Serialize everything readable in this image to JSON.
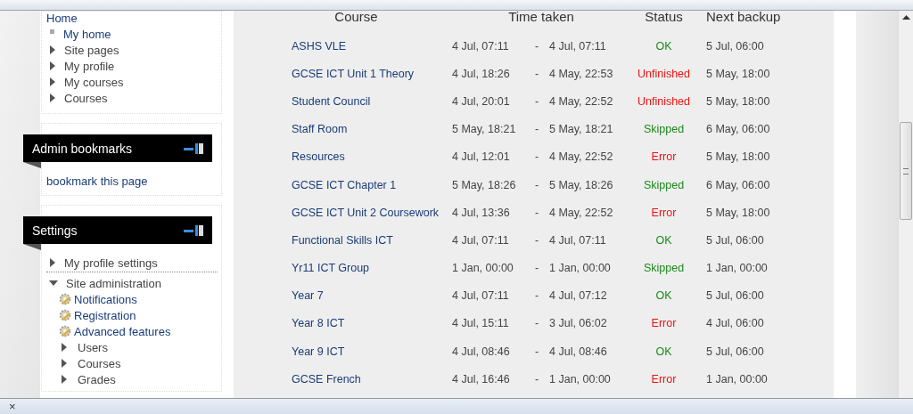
{
  "navigation": {
    "home": "Home",
    "items": [
      {
        "label": "My home",
        "kind": "leaf"
      },
      {
        "label": "Site pages",
        "kind": "branch"
      },
      {
        "label": "My profile",
        "kind": "branch"
      },
      {
        "label": "My courses",
        "kind": "branch"
      },
      {
        "label": "Courses",
        "kind": "branch"
      }
    ]
  },
  "admin_bookmarks": {
    "title": "Admin bookmarks",
    "link": "bookmark this page"
  },
  "settings": {
    "title": "Settings",
    "items": [
      {
        "label": "My profile settings",
        "expanded": false
      },
      {
        "label": "Site administration",
        "expanded": true,
        "children": [
          {
            "label": "Notifications",
            "kind": "page"
          },
          {
            "label": "Registration",
            "kind": "page"
          },
          {
            "label": "Advanced features",
            "kind": "page"
          },
          {
            "label": "Users",
            "kind": "branch"
          },
          {
            "label": "Courses",
            "kind": "branch"
          },
          {
            "label": "Grades",
            "kind": "branch"
          }
        ]
      }
    ]
  },
  "table": {
    "columns": [
      "Course",
      "Time taken",
      "Status",
      "Next backup"
    ],
    "rows": [
      {
        "course": "ASHS VLE",
        "start": "4 Jul, 07:11",
        "separator": "-",
        "end": "4 Jul, 07:11",
        "status": {
          "text": "OK",
          "kind": "ok"
        },
        "next": "5 Jul, 06:00"
      },
      {
        "course": "GCSE ICT Unit 1 Theory",
        "start": "4 Jul, 18:26",
        "separator": "-",
        "end": "4 May, 22:53",
        "status": {
          "text": "Unfinished",
          "kind": "error"
        },
        "next": "5 May, 18:00"
      },
      {
        "course": "Student Council",
        "start": "4 Jul, 20:01",
        "separator": "-",
        "end": "4 May, 22:52",
        "status": {
          "text": "Unfinished",
          "kind": "error"
        },
        "next": "5 May, 18:00"
      },
      {
        "course": "Staff Room",
        "start": "5 May, 18:21",
        "separator": "-",
        "end": "5 May, 18:21",
        "status": {
          "text": "Skipped",
          "kind": "ok"
        },
        "next": "6 May, 06:00"
      },
      {
        "course": "Resources",
        "start": "4 Jul, 12:01",
        "separator": "-",
        "end": "4 May, 22:52",
        "status": {
          "text": "Error",
          "kind": "error"
        },
        "next": "5 May, 18:00"
      },
      {
        "course": "GCSE ICT Chapter 1",
        "start": "5 May, 18:26",
        "separator": "-",
        "end": "5 May, 18:26",
        "status": {
          "text": "Skipped",
          "kind": "ok"
        },
        "next": "6 May, 06:00"
      },
      {
        "course": "GCSE ICT Unit 2 Coursework",
        "start": "4 Jul, 13:36",
        "separator": "-",
        "end": "4 May, 22:52",
        "status": {
          "text": "Error",
          "kind": "error"
        },
        "next": "5 May, 18:00"
      },
      {
        "course": "Functional Skills ICT",
        "start": "4 Jul, 07:11",
        "separator": "-",
        "end": "4 Jul, 07:11",
        "status": {
          "text": "OK",
          "kind": "ok"
        },
        "next": "5 Jul, 06:00"
      },
      {
        "course": "Yr11 ICT Group",
        "start": "1 Jan, 00:00",
        "separator": "-",
        "end": "1 Jan, 00:00",
        "status": {
          "text": "Skipped",
          "kind": "ok"
        },
        "next": "1 Jan, 00:00"
      },
      {
        "course": "Year 7",
        "start": "4 Jul, 07:11",
        "separator": "-",
        "end": "4 Jul, 07:12",
        "status": {
          "text": "OK",
          "kind": "ok"
        },
        "next": "5 Jul, 06:00"
      },
      {
        "course": "Year 8 ICT",
        "start": "4 Jul, 15:11",
        "separator": "-",
        "end": "3 Jul, 06:02",
        "status": {
          "text": "Error",
          "kind": "error"
        },
        "next": "4 Jul, 06:00"
      },
      {
        "course": "Year 9 ICT",
        "start": "4 Jul, 08:46",
        "separator": "-",
        "end": "4 Jul, 08:46",
        "status": {
          "text": "OK",
          "kind": "ok"
        },
        "next": "5 Jul, 06:00"
      },
      {
        "course": "GCSE French",
        "start": "4 Jul, 16:46",
        "separator": "-",
        "end": "1 Jan, 00:00",
        "status": {
          "text": "Error",
          "kind": "error"
        },
        "next": "1 Jan, 00:00"
      }
    ]
  },
  "status_bar": {
    "close": "×"
  }
}
